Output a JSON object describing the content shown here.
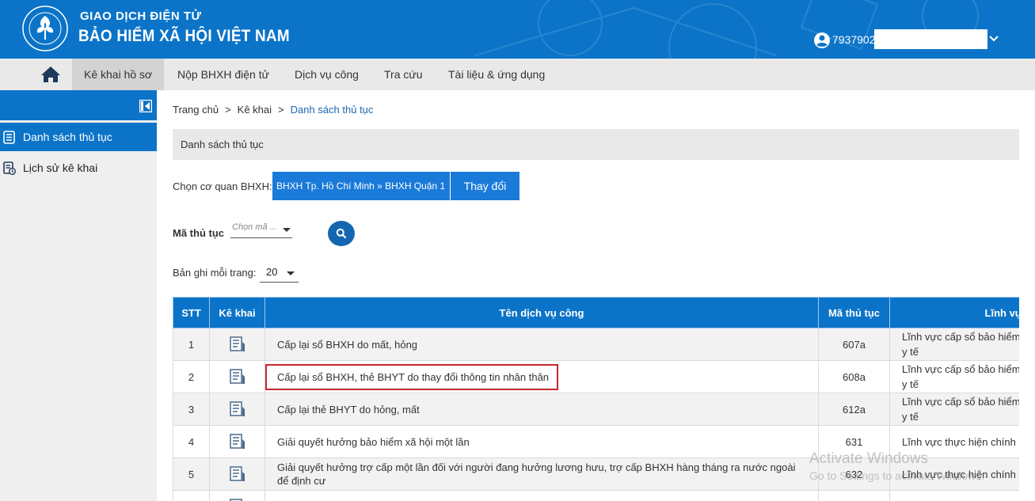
{
  "header": {
    "brand_line1": "GIAO DỊCH ĐIỆN TỬ",
    "brand_line2": "BẢO HIỂM XÃ HỘI VIỆT NAM",
    "user_id": "7937902"
  },
  "nav": {
    "items": [
      "Kê khai hồ sơ",
      "Nộp BHXH điện tử",
      "Dịch vụ công",
      "Tra cứu",
      "Tài liệu & ứng dụng"
    ]
  },
  "sidebar": {
    "items": [
      "Danh sách thủ tục",
      "Lịch sử kê khai"
    ]
  },
  "breadcrumb": [
    "Trang chủ",
    "Kê khai",
    "Danh sách thủ tục"
  ],
  "panel_title": "Danh sách thủ tục",
  "agency": {
    "label": "Chọn cơ quan BHXH:",
    "value": "BHXH Tp. Hồ Chí Minh » BHXH Quận 1",
    "change_button": "Thay đổi"
  },
  "filter": {
    "code_label": "Mã thủ tục",
    "code_placeholder": "Chọn mã ...",
    "page_label": "Bản ghi mỗi trang:",
    "page_size": "20"
  },
  "table": {
    "headers": [
      "STT",
      "Kê khai",
      "Tên dịch vụ công",
      "Mã thủ tục",
      "Lĩnh vực"
    ],
    "rows": [
      {
        "stt": "1",
        "name": "Cấp lại sổ BHXH do mất, hỏng",
        "code": "607a",
        "field_l1": "Lĩnh vực cấp sổ bảo hiểm",
        "field_l2": "y tế"
      },
      {
        "stt": "2",
        "name": "Cấp lại sổ BHXH, thẻ BHYT do thay đổi thông tin nhân thân",
        "code": "608a",
        "field_l1": "Lĩnh vực cấp sổ bảo hiểm",
        "field_l2": "y tế"
      },
      {
        "stt": "3",
        "name": "Cấp lại thẻ BHYT do hỏng, mất",
        "code": "612a",
        "field_l1": "Lĩnh vực cấp sổ bảo hiểm",
        "field_l2": "y tế"
      },
      {
        "stt": "4",
        "name": "Giải quyết hưởng bảo hiểm xã hội một lần",
        "code": "631",
        "field_l1": "Lĩnh vực thực hiện chính",
        "field_l2": ""
      },
      {
        "stt": "5",
        "name_l1": "Giải quyết hưởng trợ cấp một lần đối với người đang hưởng lương hưu, trợ cấp BHXH hàng tháng ra nước ngoài",
        "name_l2": "để định cư",
        "code": "632",
        "field_l1": "Lĩnh vực thực hiện chính",
        "field_l2": ""
      }
    ]
  },
  "watermark": {
    "line1": "Activate Windows",
    "line2": "Go to Settings to activate Windows."
  },
  "colors": {
    "primary": "#0b74c8",
    "button": "#1a7ad9",
    "highlight_border": "#c8282e"
  }
}
